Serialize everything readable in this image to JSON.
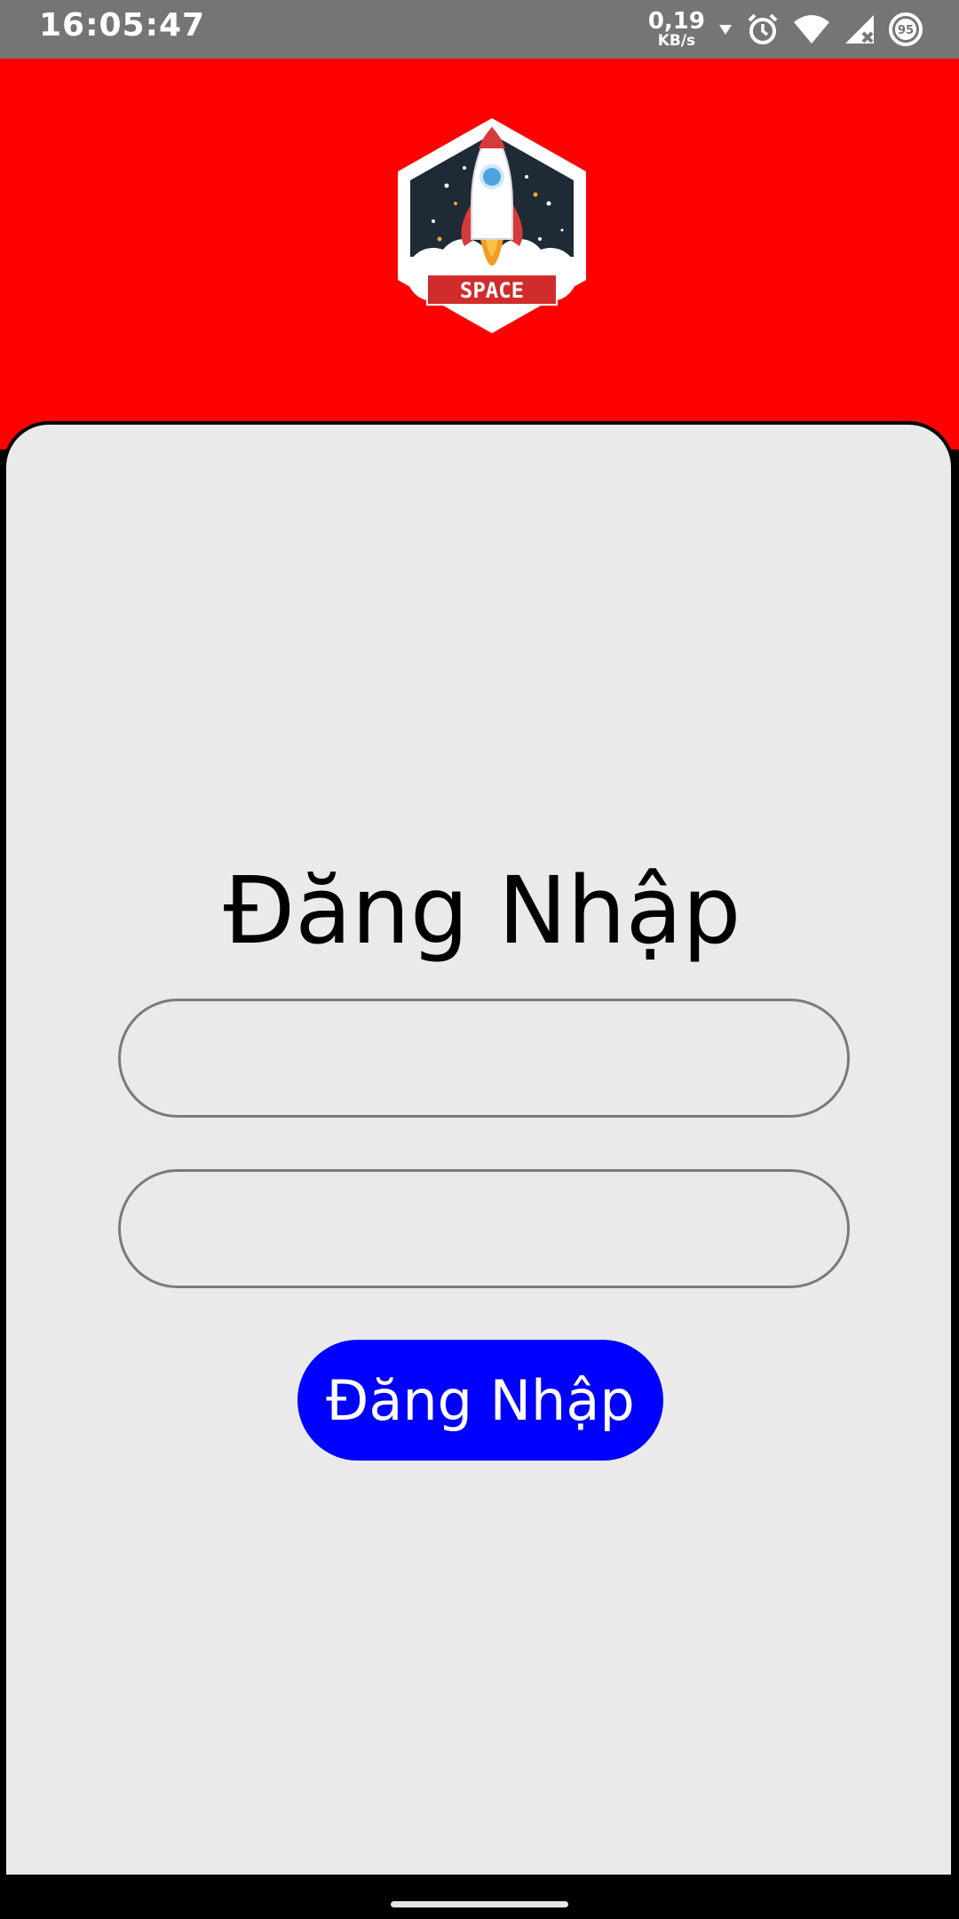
{
  "status_bar": {
    "time": "16:05:47",
    "net_speed_value": "0,19",
    "net_speed_unit": "KB/s",
    "battery_level": "95",
    "icons": [
      "download-arrow-icon",
      "alarm-icon",
      "wifi-icon",
      "signal-icon",
      "battery-icon"
    ]
  },
  "header": {
    "background_color": "#ff0000",
    "logo_text": "SPACE"
  },
  "login": {
    "title": "Đăng Nhập",
    "username_value": "",
    "password_value": "",
    "button_label": "Đăng Nhập",
    "button_color": "#0000ff"
  }
}
